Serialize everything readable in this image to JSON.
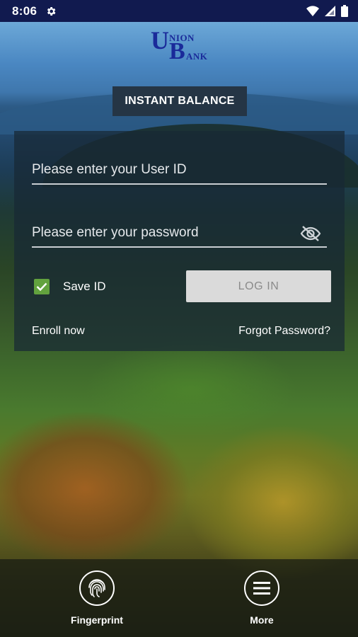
{
  "status_bar": {
    "time": "8:06",
    "icons": [
      "gear-icon",
      "wifi-icon",
      "cell-signal-icon",
      "battery-icon"
    ]
  },
  "logo": {
    "u": "U",
    "nion": "NION",
    "b": "B",
    "ank": "ANK"
  },
  "instant_balance": {
    "label": "INSTANT BALANCE"
  },
  "login": {
    "user_placeholder": "Please enter your User ID",
    "password_placeholder": "Please enter your password",
    "save_id_label": "Save ID",
    "save_id_checked": true,
    "login_button": "LOG IN",
    "enroll_link": "Enroll now",
    "forgot_link": "Forgot Password?"
  },
  "bottom_nav": {
    "fingerprint": "Fingerprint",
    "more": "More"
  },
  "colors": {
    "status_bar": "#111a4f",
    "logo": "#1a2a9a",
    "checkbox": "#62a23e",
    "login_button_bg": "#dadada"
  }
}
